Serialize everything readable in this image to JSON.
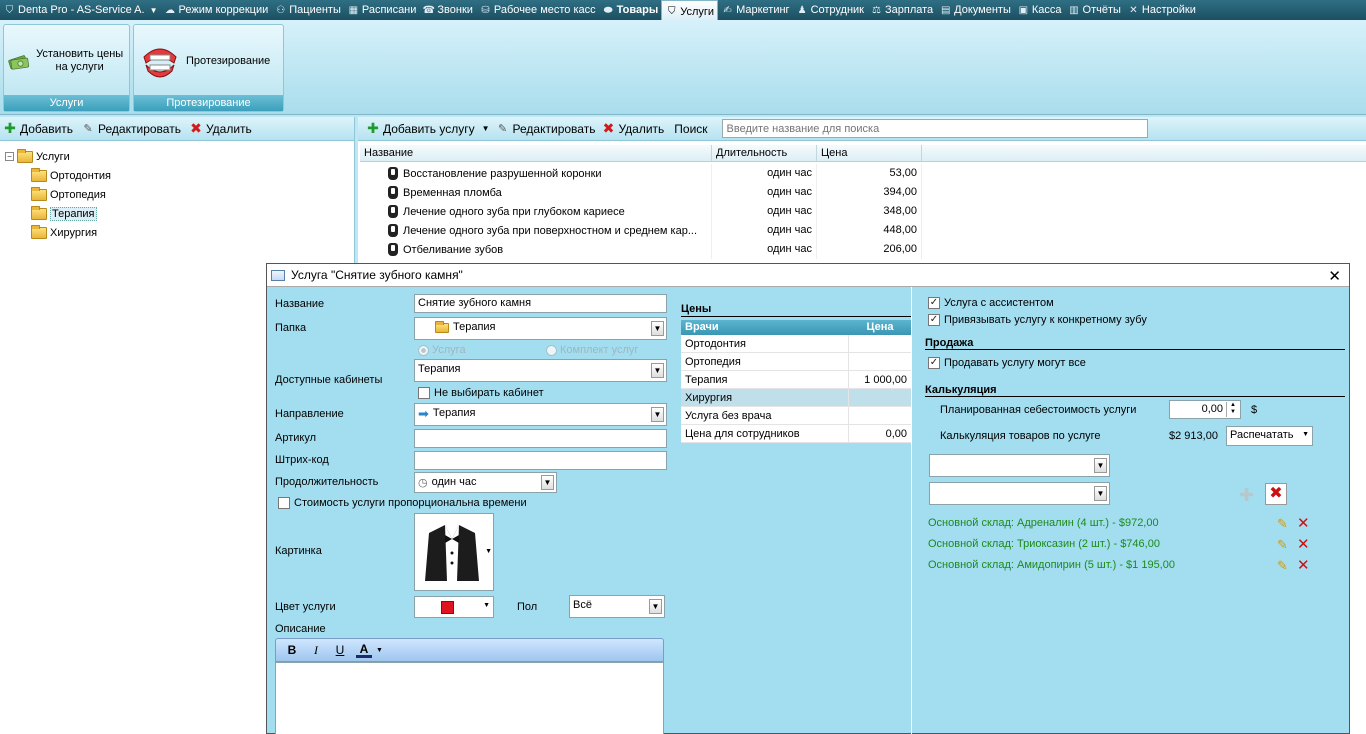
{
  "topmenu": [
    {
      "label": "Denta Pro - AS-Service A.",
      "icon": "tooth-icon",
      "caret": true
    },
    {
      "label": "Режим коррекции",
      "icon": "cloud-icon"
    },
    {
      "label": "Пациенты",
      "icon": "patients-icon"
    },
    {
      "label": "Расписани",
      "icon": "calendar-icon"
    },
    {
      "label": "Звонки",
      "icon": "phone-icon"
    },
    {
      "label": "Рабочее место касс",
      "icon": "cashier-icon"
    },
    {
      "label": "Товары",
      "icon": "goods-icon",
      "bold": true
    },
    {
      "label": "Услуги",
      "icon": "tooth-icon",
      "active": true
    },
    {
      "label": "Маркетинг",
      "icon": "marketing-icon"
    },
    {
      "label": "Сотрудник",
      "icon": "staff-icon"
    },
    {
      "label": "Зарплата",
      "icon": "salary-icon"
    },
    {
      "label": "Документы",
      "icon": "documents-icon"
    },
    {
      "label": "Касса",
      "icon": "cashbox-icon"
    },
    {
      "label": "Отчёты",
      "icon": "reports-icon"
    },
    {
      "label": "Настройки",
      "icon": "settings-icon"
    }
  ],
  "ribbon": {
    "group1": {
      "button": "Установить цены на услуги",
      "label": "Услуги"
    },
    "group2": {
      "button": "Протезирование",
      "label": "Протезирование"
    }
  },
  "left_toolbar": {
    "add": "Добавить",
    "edit": "Редактировать",
    "delete": "Удалить"
  },
  "tree": {
    "root": "Услуги",
    "children": [
      "Ортодонтия",
      "Ортопедия",
      "Терапия",
      "Хирургия"
    ],
    "selected": "Терапия"
  },
  "right_toolbar": {
    "add": "Добавить услугу",
    "edit": "Редактировать",
    "delete": "Удалить",
    "search_label": "Поиск",
    "search_placeholder": "Введите название для поиска"
  },
  "grid": {
    "columns": [
      "Название",
      "Длительность",
      "Цена"
    ],
    "rows": [
      {
        "name": "Восстановление разрушенной коронки",
        "duration": "один час",
        "price": "53,00"
      },
      {
        "name": "Временная пломба",
        "duration": "один час",
        "price": "394,00"
      },
      {
        "name": "Лечение одного зуба при глубоком кариесе",
        "duration": "один час",
        "price": "348,00"
      },
      {
        "name": "Лечение одного зуба при поверхностном и среднем кар...",
        "duration": "один час",
        "price": "448,00"
      },
      {
        "name": "Отбеливание зубов",
        "duration": "один час",
        "price": "206,00"
      }
    ]
  },
  "dialog": {
    "title": "Услуга \"Снятие зубного камня\"",
    "labels": {
      "name": "Название",
      "folder": "Папка",
      "cabinets": "Доступные кабинеты",
      "direction": "Направление",
      "article": "Артикул",
      "barcode": "Штрих-код",
      "duration": "Продолжительность",
      "picture": "Картинка",
      "color": "Цвет услуги",
      "gender": "Пол",
      "description": "Описание"
    },
    "values": {
      "name": "Снятие зубного камня",
      "folder": "Терапия",
      "cabinets": "Терапия",
      "direction": "Терапия",
      "article": "",
      "barcode": "",
      "duration": "один час",
      "gender": "Всё",
      "color": "#e0141e"
    },
    "radio_service": "Услуга",
    "radio_kit": "Комплект услуг",
    "chk_no_cabinet": "Не выбирать кабинет",
    "chk_proportional": "Стоимость услуги пропорциональна времени",
    "format_buttons": [
      "B",
      "I",
      "U",
      "A"
    ],
    "prices": {
      "title": "Цены",
      "col_doctors": "Врачи",
      "col_price": "Цена",
      "rows": [
        {
          "name": "Ортодонтия",
          "price": ""
        },
        {
          "name": "Ортопедия",
          "price": ""
        },
        {
          "name": "Терапия",
          "price": "1 000,00"
        },
        {
          "name": "Хирургия",
          "price": ""
        },
        {
          "name": "Услуга без врача",
          "price": ""
        },
        {
          "name": "Цена для сотрудников",
          "price": "0,00"
        }
      ]
    },
    "right": {
      "chk_assistant": "Услуга с ассистентом",
      "chk_bind_tooth": "Привязывать услугу к конкретному зубу",
      "sale_title": "Продажа",
      "chk_sell_all": "Продавать услугу могут все",
      "calc_title": "Калькуляция",
      "planned_cost_label": "Планированная себестоимость услуги",
      "planned_cost_value": "0,00",
      "currency": "$",
      "calc_goods_label": "Калькуляция товаров по услуге",
      "calc_goods_value": "$2 913,00",
      "print_button": "Распечатать",
      "items": [
        "Основной склад: Адреналин (4 шт.) - $972,00",
        "Основной склад: Триоксазин (2 шт.) - $746,00",
        "Основной склад: Амидопирин (5 шт.) - $1 195,00"
      ]
    }
  }
}
